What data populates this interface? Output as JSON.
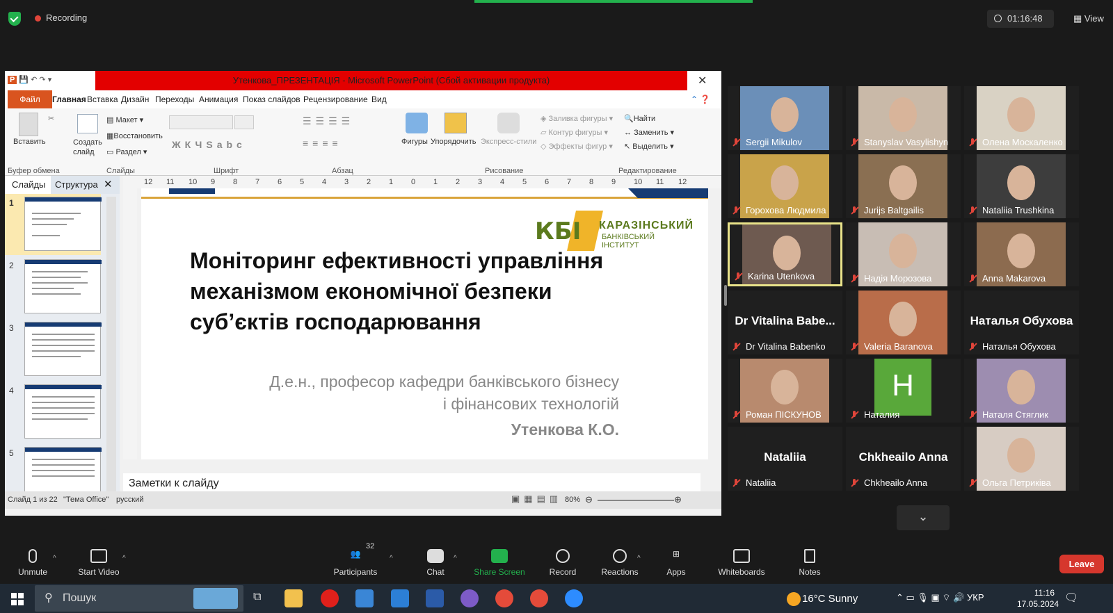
{
  "zoom": {
    "recording_label": "Recording",
    "timer": "01:16:48",
    "view_label": "View",
    "toolbar": {
      "unmute": "Unmute",
      "start_video": "Start Video",
      "participants": "Participants",
      "participants_count": "32",
      "chat": "Chat",
      "share_screen": "Share Screen",
      "record": "Record",
      "reactions": "Reactions",
      "apps": "Apps",
      "whiteboards": "Whiteboards",
      "notes": "Notes",
      "leave": "Leave"
    },
    "colors": {
      "share_green": "#23b14d",
      "leave_red": "#d6372d",
      "active_speaker": "#e9e38a"
    }
  },
  "ppt": {
    "window_title": "Утенкова_ПРЕЗЕНТАЦІЯ - Microsoft PowerPoint (Сбой активации продукта)",
    "tabs": [
      "Файл",
      "Главная",
      "Вставка",
      "Дизайн",
      "Переходы",
      "Анимация",
      "Показ слайдов",
      "Рецензирование",
      "Вид"
    ],
    "ribbon": {
      "paste": "Вставить",
      "new_slide": "Создать слайд",
      "layout": "Макет",
      "reset": "Восстановить",
      "section": "Раздел",
      "shapes": "Фигуры",
      "arrange": "Упорядочить",
      "quick_styles": "Экспресс-стили",
      "shape_fill": "Заливка фигуры",
      "shape_outline": "Контур фигуры",
      "shape_effects": "Эффекты фигур",
      "find": "Найти",
      "replace": "Заменить",
      "select": "Выделить",
      "groups": [
        "Буфер обмена",
        "Слайды",
        "Шрифт",
        "Абзац",
        "Рисование",
        "Редактирование"
      ]
    },
    "panel_tabs": {
      "slides": "Слайды",
      "outline": "Структура"
    },
    "slide_numbers": [
      "1",
      "2",
      "3",
      "4",
      "5"
    ],
    "ruler_labels": [
      "12",
      "11",
      "10",
      "9",
      "8",
      "7",
      "6",
      "5",
      "4",
      "3",
      "2",
      "1",
      "0",
      "1",
      "2",
      "3",
      "4",
      "5",
      "6",
      "7",
      "8",
      "9",
      "10",
      "11",
      "12"
    ],
    "slide": {
      "logo_letters": "КБІ",
      "logo_line1": "КАРАЗІНСЬКИЙ",
      "logo_line2": "БАНКІВСЬКИЙ",
      "logo_line3": "ІНСТИТУТ",
      "title_line1": "Моніторинг ефективності управління",
      "title_line2": "механізмом економічної безпеки",
      "title_line3": "суб’єктів господарювання",
      "subtitle_line1": "Д.е.н., професор кафедри банківського бізнесу",
      "subtitle_line2": "і фінансових технологій",
      "author": "Утенкова К.О."
    },
    "notes_placeholder": "Заметки к слайду",
    "status": {
      "slide_of": "Слайд 1 из 22",
      "theme": "\"Тема Office\"",
      "language": "русский",
      "zoom": "80%"
    }
  },
  "participants": [
    {
      "name": "Sergii Mikulov",
      "video": true,
      "color": "#6b8fb8"
    },
    {
      "name": "Stanyslav Vasylishyn",
      "video": true,
      "color": "#c9b9a8"
    },
    {
      "name": "Олена Москаленко",
      "video": true,
      "color": "#d9d2c4"
    },
    {
      "name": "Горохова Людмила",
      "video": true,
      "color": "#c9a34a"
    },
    {
      "name": "Jurijs Baltgailis",
      "video": true,
      "color": "#8a6f52"
    },
    {
      "name": "Nataliia Trushkina",
      "video": true,
      "color": "#3d3d3d"
    },
    {
      "name": "Karina Utenkova",
      "video": true,
      "color": "#6e5a50"
    },
    {
      "name": "Надія Морозова",
      "video": true,
      "color": "#c8bdb4"
    },
    {
      "name": "Anna Makarova",
      "video": true,
      "color": "#8c6b4f"
    },
    {
      "name": "Dr Vitalina Babenko",
      "video": false,
      "display": "Dr Vitalina Babe..."
    },
    {
      "name": "Valeria Baranova",
      "video": true,
      "color": "#b96d4a"
    },
    {
      "name": "Наталья Обухова",
      "video": false,
      "display": "Наталья Обухова"
    },
    {
      "name": "Роман ПІСКУНОВ",
      "video": true,
      "color": "#b88a6e"
    },
    {
      "name": "Наталия",
      "video": false,
      "display": "H",
      "color": "#59a83a"
    },
    {
      "name": "Наталя Стяглик",
      "video": true,
      "color": "#9d8db0"
    },
    {
      "name": "Nataliia",
      "video": false,
      "display": "Nataliia"
    },
    {
      "name": "Chkheailo Anna",
      "video": false,
      "display": "Chkheailo Anna"
    },
    {
      "name": "Ольга Петриківа",
      "video": true,
      "color": "#d7ccc3"
    }
  ],
  "taskbar": {
    "search": "Пошук",
    "weather": "16°C  Sunny",
    "language": "УКР",
    "time": "11:16",
    "date": "17.05.2024"
  }
}
